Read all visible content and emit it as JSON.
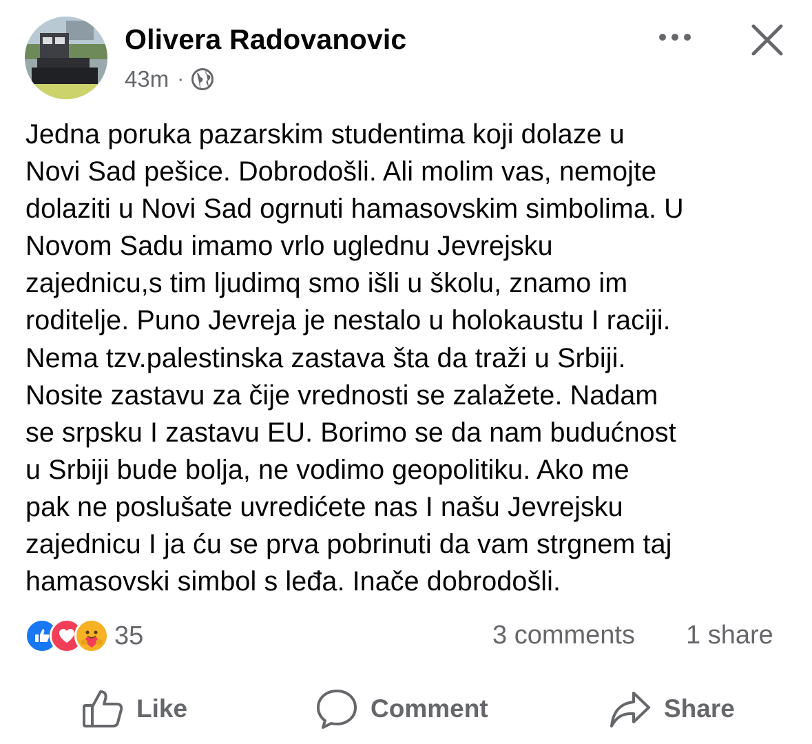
{
  "post": {
    "author": "Olivera Radovanovic",
    "time": "43m",
    "separator": "·",
    "audience_icon": "globe-icon",
    "text": "Jedna poruka pazarskim studentima koji dolaze u\nNovi Sad pešice. Dobrodošli. Ali molim vas, nemojte\ndolaziti u Novi Sad ogrnuti hamasovskim simbolima. U\nNovom Sadu imamo vrlo uglednu Jevrejsku\nzajednicu,s tim ljudimq  smo išli u školu, znamo im\nroditelje. Puno Jevreja je nestalo u holokaustu I raciji.\nNema tzv.palestinska zastava šta da traži u Srbiji.\nNosite zastavu za čije  vrednosti se zalažete. Nadam\nse srpsku I zastavu EU. Borimo se da nam budućnost\nu Srbiji bude bolja, ne vodimo geopolitiku. Ako me\npak ne poslušate uvredićete nas I našu Jevrejsku\nzajednicu I ja ću se prva pobrinuti da vam strgnem taj\nhamasovski simbol s leđa. Inače dobrodošli."
  },
  "header_icons": {
    "more": "more-icon",
    "close": "close-icon"
  },
  "stats": {
    "reactions": [
      "like",
      "love",
      "care"
    ],
    "reaction_count": "35",
    "comments": "3 comments",
    "shares": "1 share"
  },
  "actions": {
    "like": "Like",
    "comment": "Comment",
    "share": "Share"
  },
  "colors": {
    "text": "#050505",
    "secondary": "#65676b",
    "like_blue": "#1877f2",
    "love_red": "#f33e58",
    "care_yellow": "#f7b125"
  }
}
